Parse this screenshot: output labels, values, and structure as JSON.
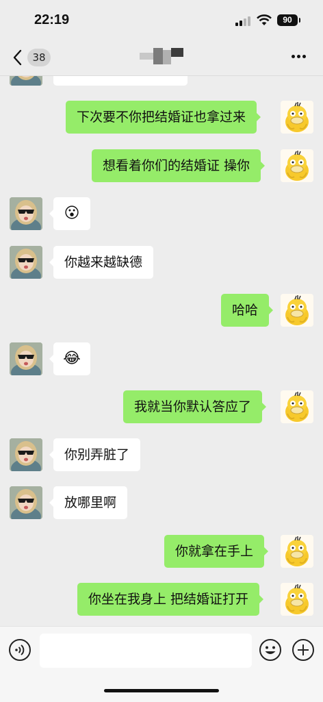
{
  "status": {
    "time": "22:19",
    "battery": "90"
  },
  "nav": {
    "back_count": "38"
  },
  "messages": [
    {
      "dir": "out",
      "text": "下次要不你把结婚证也拿过来"
    },
    {
      "dir": "out",
      "text": "想看着你们的结婚证 操你"
    },
    {
      "dir": "in",
      "text": "😮"
    },
    {
      "dir": "in",
      "text": "你越来越缺德"
    },
    {
      "dir": "out",
      "text": "哈哈"
    },
    {
      "dir": "in",
      "text": "😂"
    },
    {
      "dir": "out",
      "text": "我就当你默认答应了"
    },
    {
      "dir": "in",
      "text": "你别弄脏了"
    },
    {
      "dir": "in",
      "text": "放哪里啊"
    },
    {
      "dir": "out",
      "text": "你就拿在手上"
    },
    {
      "dir": "out",
      "text": "你坐在我身上 把结婚证打开"
    }
  ],
  "input": {
    "placeholder": ""
  },
  "colors": {
    "outgoing": "#95ec69",
    "incoming": "#ffffff",
    "background": "#ededed"
  }
}
